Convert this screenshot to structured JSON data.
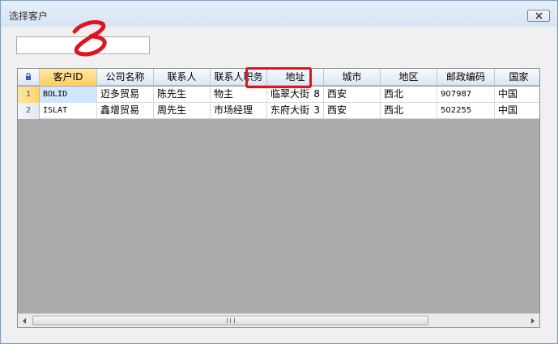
{
  "window": {
    "title": "选择客户"
  },
  "search": {
    "value": "",
    "placeholder": ""
  },
  "grid": {
    "columns": [
      "客户ID",
      "公司名称",
      "联系人",
      "联系人职务",
      "地址",
      "城市",
      "地区",
      "邮政编码",
      "国家"
    ],
    "rows": [
      {
        "num": "1",
        "id": "BOLID",
        "company": "迈多贸易",
        "contact": "陈先生",
        "title": "物主",
        "address": "临翠大街",
        "addr_no": "8",
        "city": "西安",
        "region": "西北",
        "postal": "907987",
        "country": "中国"
      },
      {
        "num": "2",
        "id": "ISLAT",
        "company": "鑫增贸易",
        "contact": "周先生",
        "title": "市场经理",
        "address": "东府大街",
        "addr_no": "3",
        "city": "西安",
        "region": "西北",
        "postal": "502255",
        "country": "中国"
      }
    ]
  },
  "icons": {
    "corner": "lock-icon",
    "close": "close-icon",
    "scroll_left": "arrow-left-icon",
    "scroll_right": "arrow-right-icon"
  },
  "colors": {
    "annotation": "#e0141e",
    "selected_header": "#ffcc5a",
    "active_cell": "#cfe6fb",
    "grid_empty": "#ababab"
  }
}
